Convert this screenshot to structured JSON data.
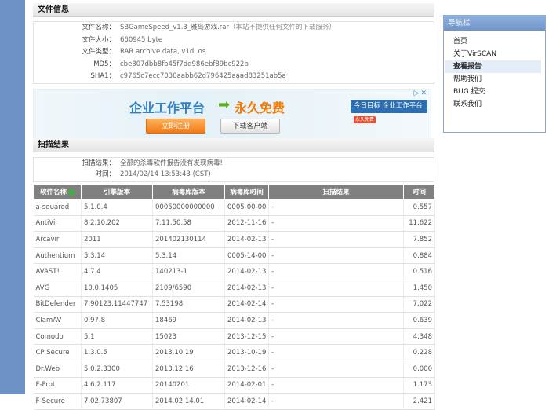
{
  "file_info": {
    "header": "文件信息",
    "rows": [
      {
        "label": "文件名称：",
        "value": "SBGameSpeed_v1.3_雅岛游戏.rar",
        "note": "（本站不提供任何文件的下载服务）"
      },
      {
        "label": "文件大小：",
        "value": "660945 byte"
      },
      {
        "label": "文件类型：",
        "value": "RAR archive data, v1d, os"
      },
      {
        "label": "MD5：",
        "value": "cbe807dbb8fb45f7dd986ebf89bc922b"
      },
      {
        "label": "SHA1：",
        "value": "c9765c7ecc7030aabb62d796425aaad83251ab5a"
      }
    ]
  },
  "ad": {
    "title": "企业工作平台",
    "arrow": "➡",
    "free": "永久免费",
    "register_label": "立即注册",
    "download_label": "下载客户端",
    "right_text": "今日目标 企业工作平台",
    "right_badge": "永久免费",
    "choice": "▷✕"
  },
  "scan": {
    "header": "扫描结果",
    "result_label": "扫描结果：",
    "result_value": "全部的杀毒软件报告没有发现病毒!",
    "time_label": "时间：",
    "time_value": "2014/02/14 13:53:43 (CST)",
    "columns": [
      "软件名称",
      "引擎版本",
      "病毒库版本",
      "病毒库时间",
      "扫描结果",
      "时间"
    ],
    "rows": [
      [
        "a-squared",
        "5.1.0.4",
        "00050000000000",
        "0005-00-00",
        "-",
        "0.557"
      ],
      [
        "AntiVir",
        "8.2.10.202",
        "7.11.50.58",
        "2012-11-16",
        "-",
        "11.622"
      ],
      [
        "Arcavir",
        "2011",
        "201402130114",
        "2014-02-13",
        "-",
        "7.852"
      ],
      [
        "Authentium",
        "5.3.14",
        "5.3.14",
        "0005-14-00",
        "-",
        "0.884"
      ],
      [
        "AVAST!",
        "4.7.4",
        "140213-1",
        "2014-02-13",
        "-",
        "0.516"
      ],
      [
        "AVG",
        "10.0.1405",
        "2109/6590",
        "2014-02-13",
        "-",
        "1.450"
      ],
      [
        "BitDefender",
        "7.90123.11447747",
        "7.53198",
        "2014-02-14",
        "-",
        "7.022"
      ],
      [
        "ClamAV",
        "0.97.8",
        "18469",
        "2014-02-13",
        "-",
        "0.639"
      ],
      [
        "Comodo",
        "5.1",
        "15023",
        "2013-12-15",
        "-",
        "4.348"
      ],
      [
        "CP Secure",
        "1.3.0.5",
        "2013.10.19",
        "2013-10-19",
        "-",
        "0.228"
      ],
      [
        "Dr.Web",
        "5.0.2.3300",
        "2013.12.16",
        "2013-12-16",
        "-",
        "0.000"
      ],
      [
        "F-Prot",
        "4.6.2.117",
        "20140201",
        "2014-02-01",
        "-",
        "1.173"
      ],
      [
        "F-Secure",
        "7.02.73807",
        "2014.02.14.01",
        "2014-02-14",
        "-",
        "2.421"
      ]
    ]
  },
  "nav": {
    "header": "导航栏",
    "items": [
      "首页",
      "关于VirSCAN",
      "查看报告",
      "帮助我们",
      "BUG 提交",
      "联系我们"
    ],
    "active_index": 2
  },
  "colors": {
    "table_header_bg": "#808080",
    "left_strip": "#6e92c4",
    "nav_header": "#7a9fd0"
  }
}
